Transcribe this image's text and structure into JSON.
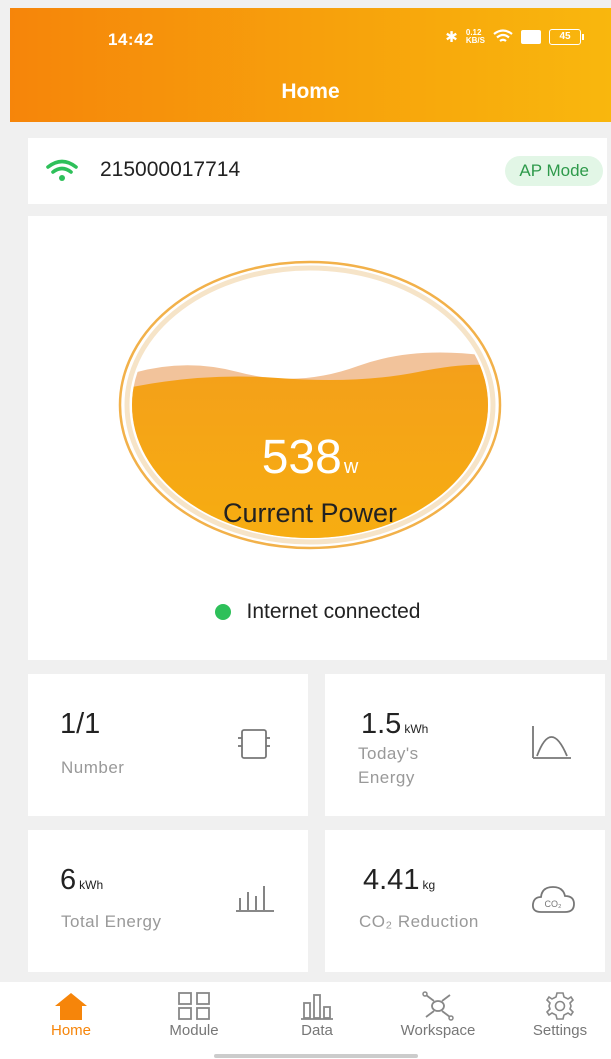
{
  "status_bar": {
    "time": "14:42",
    "net_speed_top": "0.12",
    "net_speed_bottom": "KB/S",
    "battery": "45"
  },
  "header": {
    "title": "Home"
  },
  "device": {
    "id": "215000017714",
    "mode_badge": "AP Mode"
  },
  "power": {
    "value": "538",
    "unit": "w",
    "label": "Current Power",
    "fill_level": 0.62
  },
  "connection": {
    "status": "Internet connected",
    "color": "#2ec05a"
  },
  "stats": {
    "number": {
      "value": "1/1",
      "unit": "",
      "label": "Number",
      "icon": "inverter-icon"
    },
    "today_energy": {
      "value": "1.5",
      "unit": "kWh",
      "label_line1": "Today's",
      "label_line2": "Energy",
      "icon": "curve-icon"
    },
    "total_energy": {
      "value": "6",
      "unit": "kWh",
      "label": "Total Energy",
      "icon": "bar-chart-icon"
    },
    "co2": {
      "value": "4.41",
      "unit": "kg",
      "label": "CO₂ Reduction",
      "icon": "co2-cloud-icon"
    }
  },
  "tabs": [
    {
      "label": "Home",
      "icon": "home-icon",
      "active": true
    },
    {
      "label": "Module",
      "icon": "grid-icon",
      "active": false
    },
    {
      "label": "Data",
      "icon": "data-bars-icon",
      "active": false
    },
    {
      "label": "Workspace",
      "icon": "workspace-icon",
      "active": false
    },
    {
      "label": "Settings",
      "icon": "gear-icon",
      "active": false
    }
  ],
  "colors": {
    "accent": "#f6850a",
    "gauge_fill": "#f5a516",
    "badge_bg": "#e2f6e6",
    "badge_text": "#2e9a4b"
  }
}
